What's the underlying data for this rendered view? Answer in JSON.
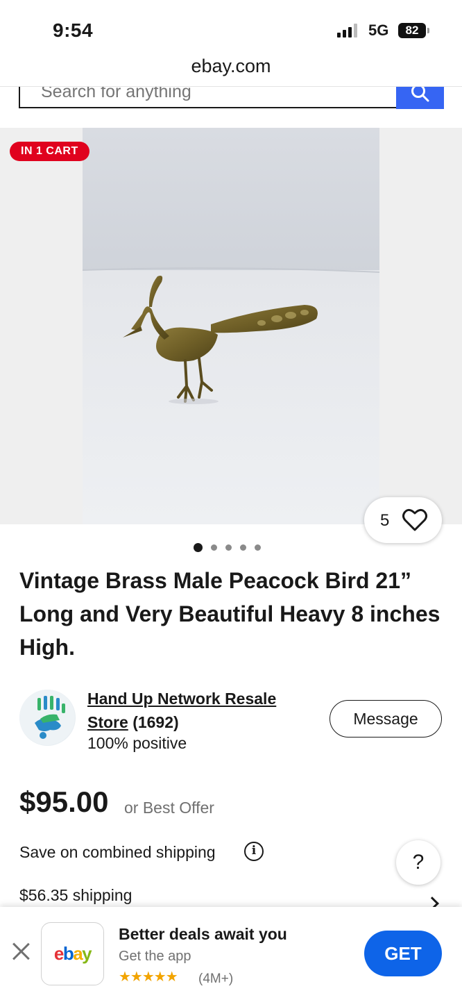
{
  "status_bar": {
    "time": "9:54",
    "network": "5G",
    "battery": "82"
  },
  "browser": {
    "url": "ebay.com"
  },
  "search": {
    "placeholder": "Search for anything"
  },
  "listing": {
    "cart_badge": "IN 1 CART",
    "watch_count": "5",
    "gallery_total_dots": 5,
    "gallery_active_index": 0,
    "title": "Vintage Brass Male Peacock Bird 21” Long and Very Beautiful Heavy 8 inches High.",
    "price": "$95.00",
    "best_offer": "or Best Offer",
    "combined_shipping": "Save on combined shipping",
    "shipping": "$56.35 shipping"
  },
  "seller": {
    "name": "Hand Up Network Resale Store",
    "feedback": "(1692)",
    "positive": "100% positive",
    "message_label": "Message"
  },
  "help": {
    "label": "?"
  },
  "app_banner": {
    "title": "Better deals await you",
    "subtitle": "Get the app",
    "stars": "★★★★★",
    "reviews": "(4M+)",
    "get_label": "GET",
    "logo_letters": [
      "e",
      "b",
      "a",
      "y"
    ]
  },
  "colors": {
    "accent": "#3665f3",
    "badge_red": "#e0021e",
    "get_blue": "#0e64e8"
  }
}
